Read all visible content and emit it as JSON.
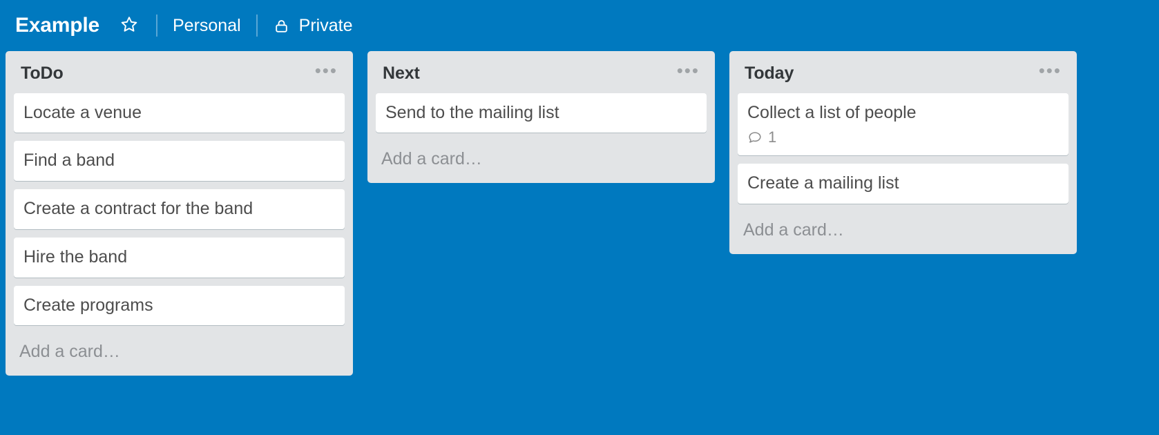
{
  "header": {
    "board_title": "Example",
    "star_icon": "star-outline-icon",
    "visibility_group": "Personal",
    "privacy_icon": "lock-icon",
    "privacy_label": "Private"
  },
  "colors": {
    "board_background": "#0079bf",
    "list_background": "#e2e4e6",
    "card_background": "#ffffff",
    "card_text": "#4d4d4d",
    "muted_text": "#8c8f93"
  },
  "lists": [
    {
      "title": "ToDo",
      "menu_icon": "ellipsis-icon",
      "add_card_label": "Add a card…",
      "cards": [
        {
          "title": "Locate a venue",
          "badges": []
        },
        {
          "title": "Find a band",
          "badges": []
        },
        {
          "title": "Create a contract for the band",
          "badges": []
        },
        {
          "title": "Hire the band",
          "badges": []
        },
        {
          "title": "Create programs",
          "badges": []
        }
      ]
    },
    {
      "title": "Next",
      "menu_icon": "ellipsis-icon",
      "add_card_label": "Add a card…",
      "cards": [
        {
          "title": "Send to the mailing list",
          "badges": []
        }
      ]
    },
    {
      "title": "Today",
      "menu_icon": "ellipsis-icon",
      "add_card_label": "Add a card…",
      "cards": [
        {
          "title": "Collect a list of people",
          "badges": [
            {
              "icon": "comment-icon",
              "value": "1"
            }
          ]
        },
        {
          "title": "Create a mailing list",
          "badges": []
        }
      ]
    }
  ]
}
